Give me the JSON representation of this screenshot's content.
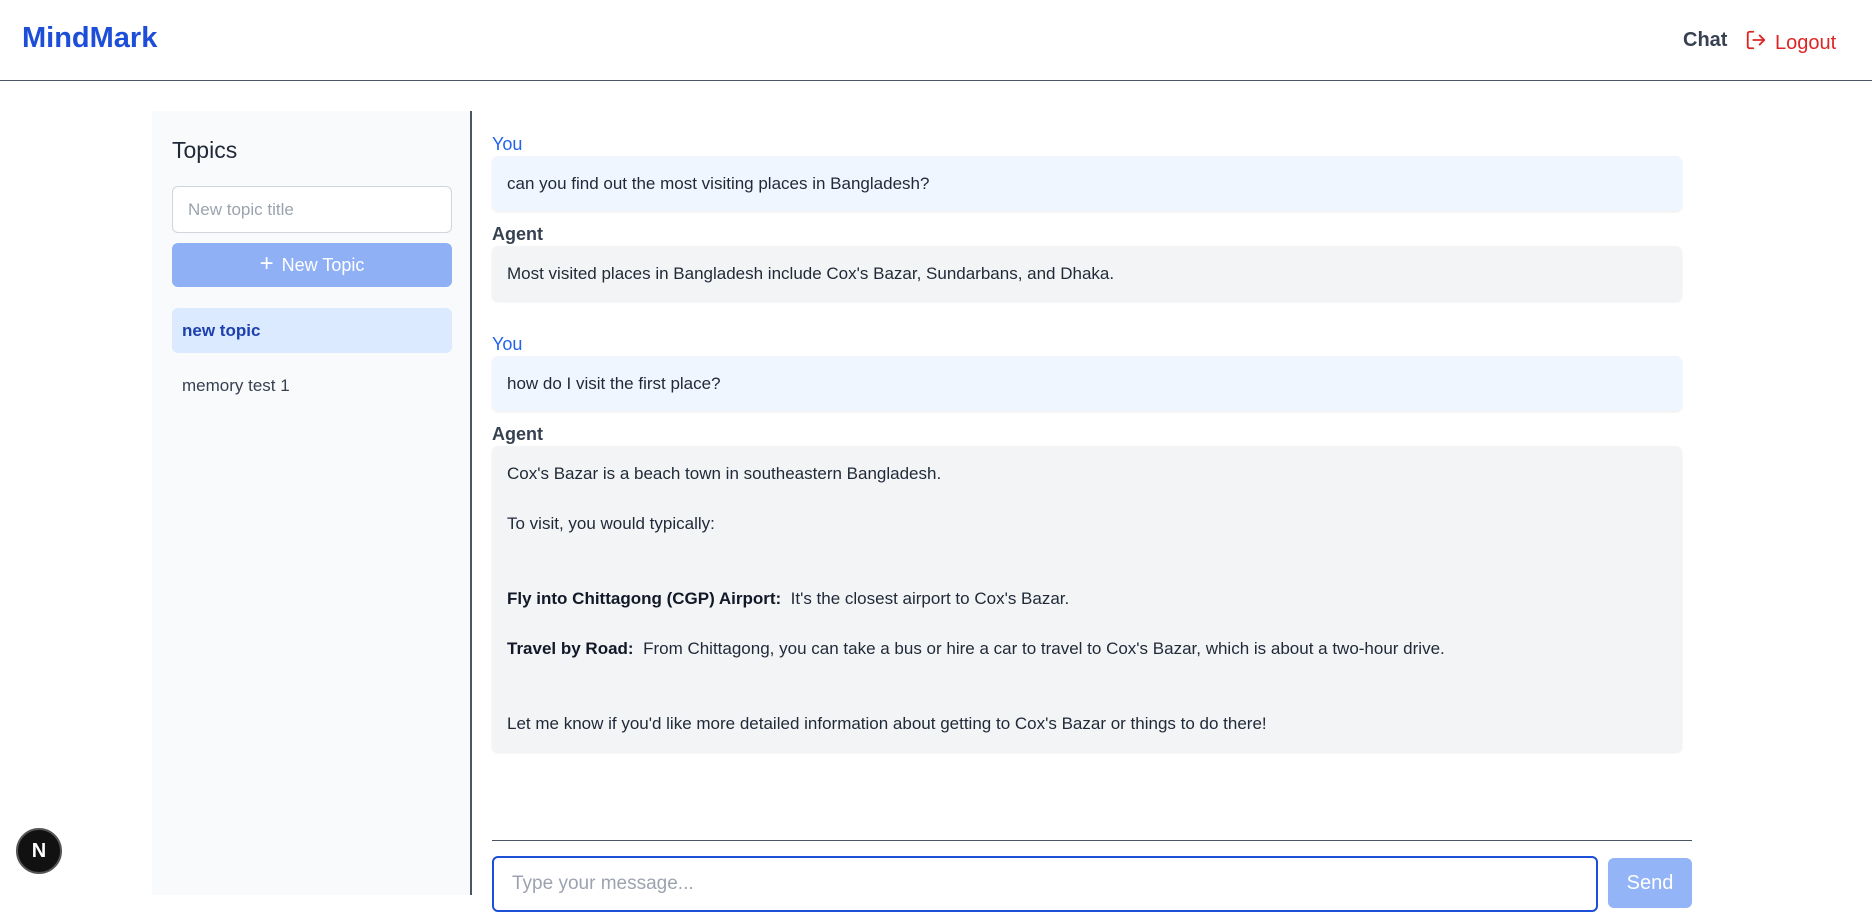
{
  "header": {
    "logo": "MindMark",
    "nav_chat": "Chat",
    "nav_logout": "Logout"
  },
  "sidebar": {
    "title": "Topics",
    "input_placeholder": "New topic title",
    "new_topic_label": "New Topic",
    "topics": [
      {
        "label": "new topic",
        "active": true
      },
      {
        "label": "memory test 1",
        "active": false
      }
    ]
  },
  "messages": [
    {
      "sender": "You",
      "lines": [
        "can you find out the most visiting places in Bangladesh?"
      ]
    },
    {
      "sender": "Agent",
      "lines": [
        "Most visited places in Bangladesh include Cox's Bazar, Sundarbans, and Dhaka."
      ]
    },
    {
      "sender": "You",
      "lines": [
        "how do I visit the first place?"
      ]
    },
    {
      "sender": "Agent",
      "intro": "Cox's Bazar is a beach town in southeastern Bangladesh.",
      "lead": "To visit, you would typically:",
      "steps": [
        {
          "bold": "Fly into Chittagong (CGP) Airport:",
          "text": "It's the closest airport to Cox's Bazar."
        },
        {
          "bold": "Travel by Road:",
          "text": "From Chittagong, you can take a bus or hire a car to travel to Cox's Bazar, which is about a two-hour drive."
        }
      ],
      "outro": "Let me know if you'd like more detailed information about getting to Cox's Bazar or things to do there!"
    }
  ],
  "composer": {
    "placeholder": "Type your message...",
    "send_label": "Send"
  },
  "badge": {
    "letter": "N"
  },
  "colors": {
    "brand": "#1d4ed8",
    "logout": "#dc2626",
    "you_label": "#2563eb"
  }
}
